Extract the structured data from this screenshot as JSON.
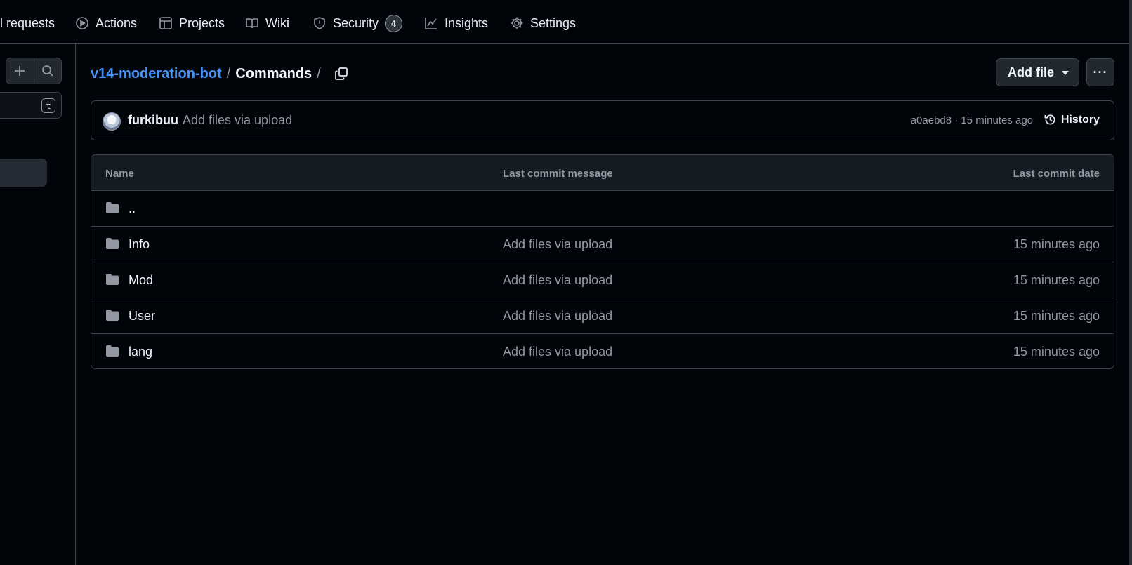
{
  "nav": {
    "items": [
      {
        "label": "ll requests",
        "icon": "pull-request-icon"
      },
      {
        "label": "Actions",
        "icon": "play-icon"
      },
      {
        "label": "Projects",
        "icon": "table-icon"
      },
      {
        "label": "Wiki",
        "icon": "book-icon"
      },
      {
        "label": "Security",
        "icon": "shield-icon",
        "count": "4"
      },
      {
        "label": "Insights",
        "icon": "graph-icon"
      },
      {
        "label": "Settings",
        "icon": "gear-icon"
      }
    ]
  },
  "sidebar": {
    "add_icon": "plus-icon",
    "search_icon": "search-icon",
    "filter_shortcut": "t"
  },
  "breadcrumb": {
    "repo": "v14-moderation-bot",
    "sep": "/",
    "current": "Commands",
    "trail_sep": "/"
  },
  "toolbar": {
    "add_file_label": "Add file",
    "more_label": "···"
  },
  "commit": {
    "author": "furkibuu",
    "message": "Add files via upload",
    "meta": "a0aebd8 · 15 minutes ago",
    "history_label": "History"
  },
  "table": {
    "headers": {
      "name": "Name",
      "message": "Last commit message",
      "date": "Last commit date"
    },
    "parent": "..",
    "rows": [
      {
        "name": "Info",
        "message": "Add files via upload",
        "date": "15 minutes ago"
      },
      {
        "name": "Mod",
        "message": "Add files via upload",
        "date": "15 minutes ago"
      },
      {
        "name": "User",
        "message": "Add files via upload",
        "date": "15 minutes ago"
      },
      {
        "name": "lang",
        "message": "Add files via upload",
        "date": "15 minutes ago"
      }
    ]
  },
  "colors": {
    "background": "#010409",
    "link": "#4493f8",
    "border": "#3d444d",
    "muted": "#9198a1"
  }
}
